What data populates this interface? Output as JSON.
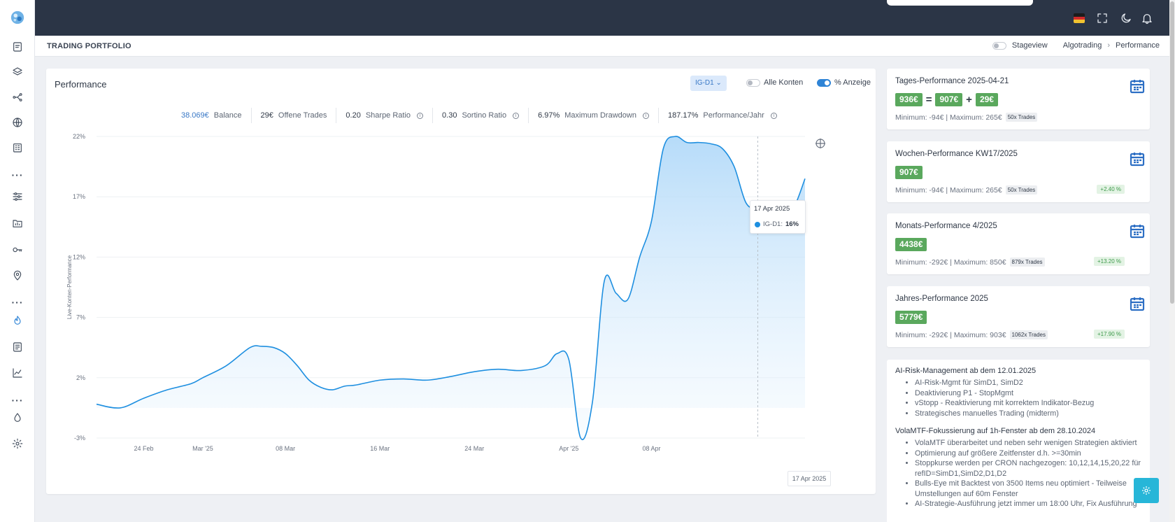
{
  "header": {
    "title": "TRADING PORTFOLIO",
    "stageview_label": "Stageview",
    "breadcrumb": [
      "Algotrading",
      "Performance"
    ]
  },
  "performance": {
    "title": "Performance",
    "account_button": "IG-D1",
    "toggle_all_accounts": "Alle Konten",
    "toggle_percent": "% Anzeige",
    "stats": [
      {
        "value": "38.069€",
        "label": "Balance"
      },
      {
        "value": "29€",
        "label": "Offene Trades"
      },
      {
        "value": "0.20",
        "label": "Sharpe Ratio"
      },
      {
        "value": "0.30",
        "label": "Sortino Ratio"
      },
      {
        "value": "6.97%",
        "label": "Maximum Drawdown"
      },
      {
        "value": "187.17%",
        "label": "Performance/Jahr"
      }
    ]
  },
  "chart_data": {
    "type": "area",
    "ylabel": "Live-Konten-Performance",
    "ylim": [
      -3,
      22
    ],
    "yticks": [
      "22%",
      "17%",
      "12%",
      "7%",
      "2%",
      "-3%"
    ],
    "xticks": [
      "24 Feb",
      "Mar '25",
      "08 Mar",
      "16 Mar",
      "24 Mar",
      "Apr '25",
      "08 Apr"
    ],
    "x": [
      "2025-02-20",
      "2025-02-22",
      "2025-02-24",
      "2025-02-26",
      "2025-02-28",
      "2025-03-01",
      "2025-03-03",
      "2025-03-05",
      "2025-03-06",
      "2025-03-07",
      "2025-03-08",
      "2025-03-09",
      "2025-03-10",
      "2025-03-11",
      "2025-03-12",
      "2025-03-13",
      "2025-03-14",
      "2025-03-16",
      "2025-03-18",
      "2025-03-20",
      "2025-03-22",
      "2025-03-24",
      "2025-03-26",
      "2025-03-28",
      "2025-03-30",
      "2025-03-31",
      "2025-04-01",
      "2025-04-02",
      "2025-04-03",
      "2025-04-04",
      "2025-04-05",
      "2025-04-06",
      "2025-04-07",
      "2025-04-08",
      "2025-04-09",
      "2025-04-10",
      "2025-04-11",
      "2025-04-12",
      "2025-04-13",
      "2025-04-14",
      "2025-04-15",
      "2025-04-16",
      "2025-04-17",
      "2025-04-18",
      "2025-04-19",
      "2025-04-20",
      "2025-04-21"
    ],
    "series": [
      {
        "name": "IG-D1",
        "values": [
          -0.2,
          -0.5,
          0.3,
          1,
          1.5,
          2,
          3,
          4.5,
          4.6,
          4.5,
          4,
          3,
          1.8,
          1.2,
          1,
          1.3,
          1.4,
          1.8,
          1.9,
          1.8,
          2.1,
          2.5,
          2.7,
          2.6,
          3,
          4,
          3.5,
          -3,
          0,
          10,
          9,
          8.5,
          12,
          15,
          21,
          22,
          21.5,
          21.5,
          21.4,
          21,
          19.5,
          16.5,
          16,
          15.9,
          15.4,
          16,
          18.5
        ]
      }
    ],
    "tooltip": {
      "date": "17 Apr 2025",
      "series": "IG-D1",
      "value": "16%"
    },
    "crosshair_label": "17 Apr 2025",
    "colors": {
      "line": "#1e8fe0",
      "fill": "#bfe0fb"
    }
  },
  "side_cards": [
    {
      "title": "Tages-Performance 2025-04-21",
      "badges": [
        "936€",
        "907€",
        "29€"
      ],
      "ops": [
        "=",
        "+"
      ],
      "minmax": "Minimum: -94€ | Maximum: 265€",
      "trades": "50x Trades",
      "pct": ""
    },
    {
      "title": "Wochen-Performance KW17/2025",
      "badges": [
        "907€"
      ],
      "ops": [],
      "minmax": "Minimum: -94€ | Maximum: 265€",
      "trades": "50x Trades",
      "pct": "+2.40 %"
    },
    {
      "title": "Monats-Performance 4/2025",
      "badges": [
        "4438€"
      ],
      "ops": [],
      "minmax": "Minimum: -292€ | Maximum: 850€",
      "trades": "879x Trades",
      "pct": "+13.20 %"
    },
    {
      "title": "Jahres-Performance 2025",
      "badges": [
        "5779€"
      ],
      "ops": [],
      "minmax": "Minimum: -292€ | Maximum: 903€",
      "trades": "1062x Trades",
      "pct": "+17.90 %"
    }
  ],
  "notes": [
    {
      "heading": "AI-Risk-Management ab dem 12.01.2025",
      "items": [
        "AI-Risk-Mgmt für SimD1, SimD2",
        "Deaktivierung P1 - StopMgmt",
        "vStopp - Reaktivierung mit korrektem Indikator-Bezug",
        "Strategisches manuelles Trading (midterm)"
      ]
    },
    {
      "heading": "VolaMTF-Fokussierung auf 1h-Fenster ab dem 28.10.2024",
      "items": [
        "VolaMTF überarbeitet und neben sehr wenigen Strategien aktiviert",
        "Optimierung auf größere Zeitfenster d.h. >=30min",
        "Stoppkurse werden per CRON nachgezogen: 10,12,14,15,20,22 für refID=SimD1,SimD2,D1,D2",
        "Bulls-Eye mit Backtest von 3500 Items neu optimiert - Teilweise Umstellungen auf 60m Fenster",
        "AI-Strategie-Ausführung jetzt immer um 18:00 Uhr, Fix Ausführung"
      ]
    }
  ],
  "colors": {
    "topbar": "#2b3546",
    "accent": "#2f84d6",
    "badge": "#5aa85d",
    "calendar": "#2d6fc4",
    "fab": "#27b6d8"
  },
  "icons": {
    "sidebar": [
      "logo-icon",
      "document-icon",
      "layers-icon",
      "share-icon",
      "globe-icon",
      "building-icon",
      "more-icon",
      "sliders-icon",
      "folder-chart-icon",
      "key-icon",
      "location-icon",
      "more-icon",
      "flame-icon",
      "report-icon",
      "line-chart-icon",
      "more-icon",
      "drop-icon",
      "gear-icon"
    ],
    "topbar": [
      "flag-de-icon",
      "fullscreen-icon",
      "moon-icon",
      "bell-icon"
    ]
  }
}
